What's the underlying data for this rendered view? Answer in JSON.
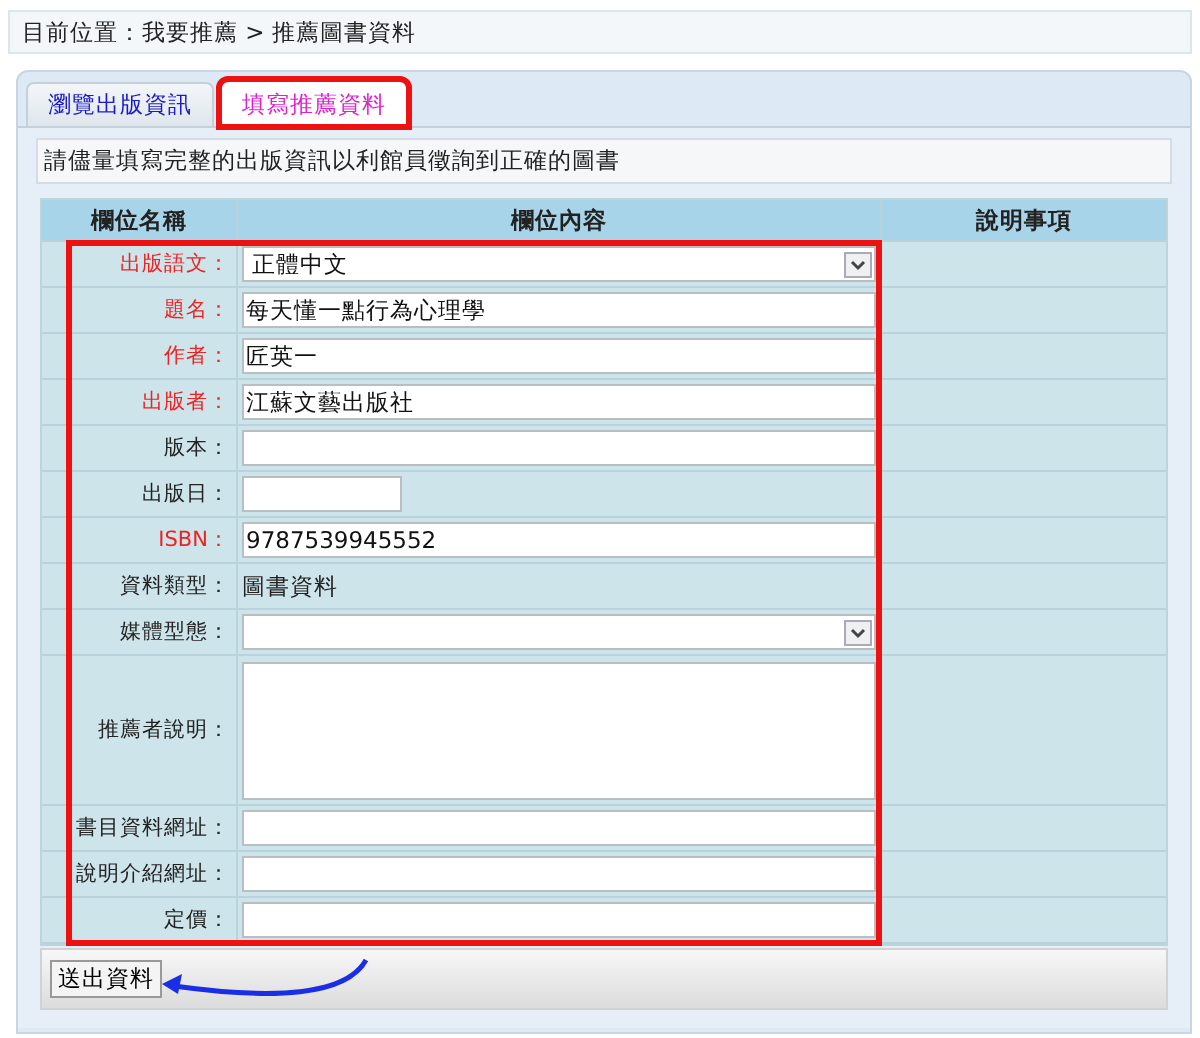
{
  "breadcrumb": "目前位置：我要推薦 > 推薦圖書資料",
  "tabs": [
    {
      "label": "瀏覽出版資訊",
      "selected": false,
      "highlighted": false
    },
    {
      "label": "填寫推薦資料",
      "selected": true,
      "highlighted": true
    }
  ],
  "intro": "請儘量填寫完整的出版資訊以利館員徵詢到正確的圖書",
  "table": {
    "columns": [
      "欄位名稱",
      "欄位內容",
      "說明事項"
    ],
    "rows": [
      {
        "label": "出版語文：",
        "required": true,
        "kind": "select",
        "value": "正體中文"
      },
      {
        "label": "題名：",
        "required": true,
        "kind": "text",
        "value": "每天懂一點行為心理學"
      },
      {
        "label": "作者：",
        "required": true,
        "kind": "text",
        "value": "匠英一"
      },
      {
        "label": "出版者：",
        "required": true,
        "kind": "text",
        "value": "江蘇文藝出版社"
      },
      {
        "label": "版本：",
        "required": false,
        "kind": "text"
      },
      {
        "label": "出版日：",
        "required": false,
        "kind": "short"
      },
      {
        "label": "ISBN：",
        "required": true,
        "kind": "text",
        "value": "9787539945552"
      },
      {
        "label": "資料類型：",
        "required": false,
        "kind": "static",
        "value": "圖書資料"
      },
      {
        "label": "媒體型態：",
        "required": false,
        "kind": "select"
      },
      {
        "label": "推薦者說明：",
        "required": false,
        "kind": "textarea"
      },
      {
        "label": "書目資料網址：",
        "required": false,
        "kind": "text"
      },
      {
        "label": "說明介紹網址：",
        "required": false,
        "kind": "text"
      },
      {
        "label": "定價：",
        "required": false,
        "kind": "text"
      }
    ]
  },
  "submit_button": "送出資料"
}
